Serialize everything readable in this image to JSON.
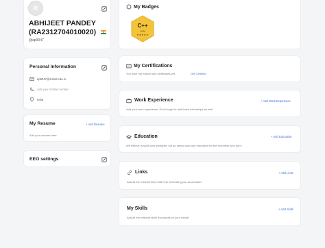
{
  "profile": {
    "name": "ABHIJEET PANDEY",
    "reg_no": "(RA2312704010020)",
    "username": "@ap9047",
    "avatar_letter": "R"
  },
  "personal": {
    "title": "Personal Information",
    "email": "ap9047@srmist.edu.in",
    "mobile_placeholder": "Add your mobile number",
    "country": "India"
  },
  "resume": {
    "title": "My Resume",
    "action": "+ Add Resume",
    "desc": "Add your resume here"
  },
  "eeo": {
    "title": "EEO settings"
  },
  "badges": {
    "title": "My Badges",
    "badge_label": "C++",
    "badge_sub": "GYM",
    "badge_stars": "★★★★★",
    "badge_color": "#f3c33c"
  },
  "certifications": {
    "title": "My Certifications",
    "desc": "You have not earned any certificates yet.",
    "link": "Get Certified"
  },
  "work": {
    "title": "Work Experience",
    "action": "+ Add Work Experience",
    "desc": "Add your work experience. Don't forget to add those internships as well."
  },
  "education": {
    "title": "Education",
    "action": "+ Add Education",
    "desc": "We believe in skills over pedigree; but go ahead add your education for the recruiters who don't."
  },
  "links": {
    "title": "Links",
    "action": "+ Add Links",
    "desc": "Add all the relevant links that help in knowing you as a hacker"
  },
  "skills": {
    "title": "My Skills",
    "action": "+ Add Skills",
    "desc": "Add all the relevant skills that speak on your behalf"
  },
  "colors": {
    "accent": "#3f6fd8",
    "badge": "#f3c33c"
  }
}
